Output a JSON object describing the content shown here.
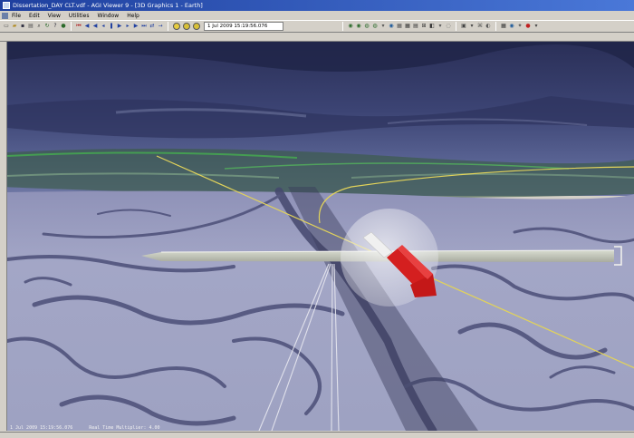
{
  "window": {
    "title": "Dissertation_DAY CLT.vdf - AGI Viewer 9 - [3D Graphics 1 - Earth]"
  },
  "menu": {
    "items": [
      "File",
      "Edit",
      "View",
      "Utilities",
      "Window",
      "Help"
    ]
  },
  "toolbar": {
    "time_value": "1 Jul 2009 15:19:56.076"
  },
  "status": {
    "time": "1 Jul 2009 15:19:56.076",
    "mode": "Real Time Multiplier: 4.00"
  },
  "colors": {
    "titlebar": "#1e3f9e",
    "chrome": "#d4d0c8",
    "orbit_line": "#e2d35a",
    "arrow_red": "#d41f1f",
    "sky_top": "#262c52",
    "ground": "#a8acc8"
  }
}
